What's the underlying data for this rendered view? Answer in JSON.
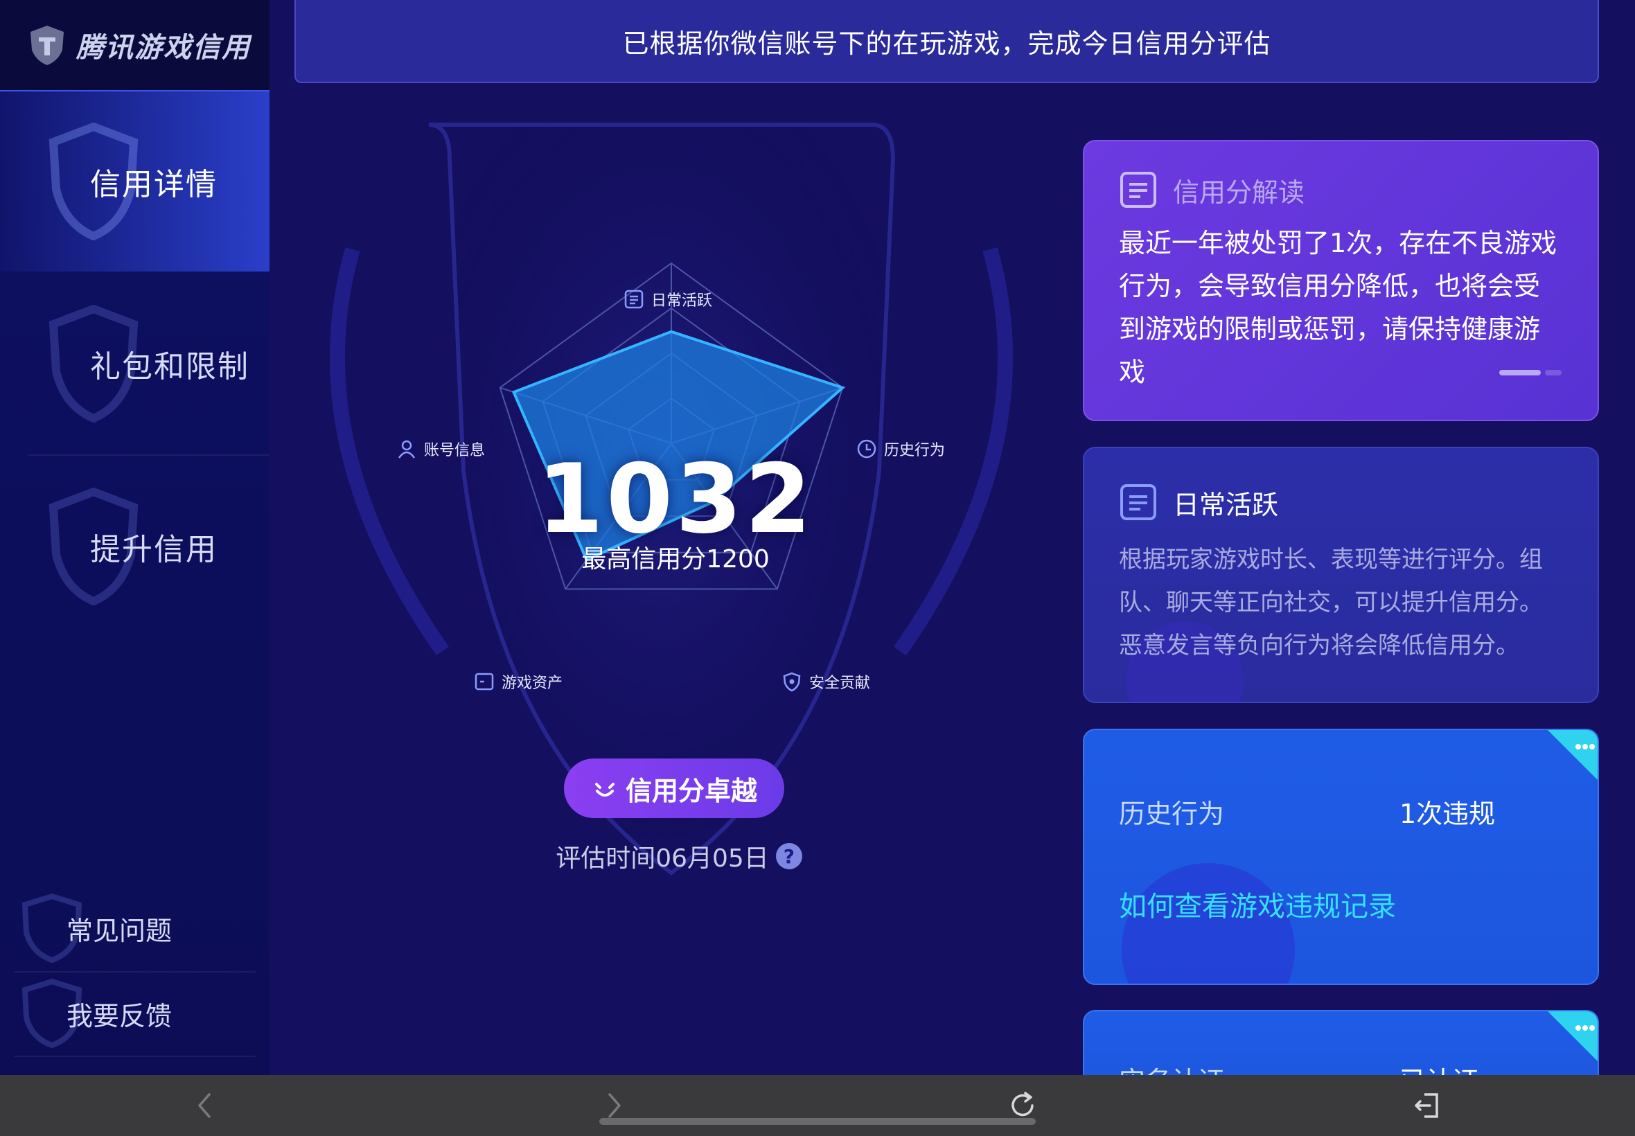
{
  "app": {
    "logo_text": "腾讯游戏信用"
  },
  "sidebar": {
    "items": [
      {
        "label": "信用详情",
        "active": true
      },
      {
        "label": "礼包和限制",
        "active": false
      },
      {
        "label": "提升信用",
        "active": false
      }
    ],
    "footer": [
      {
        "label": "常见问题"
      },
      {
        "label": "我要反馈"
      }
    ]
  },
  "banner": {
    "text": "已根据你微信账号下的在玩游戏，完成今日信用分评估"
  },
  "radar": {
    "axes": [
      "日常活跃",
      "历史行为",
      "安全贡献",
      "游戏资产",
      "账号信息"
    ],
    "values": [
      0.62,
      1.0,
      0.4,
      0.8,
      0.92
    ],
    "fill_color": "#1c7fe0",
    "stroke_color": "#35b4ff"
  },
  "score": {
    "value": "1032",
    "max_label": "最高信用分1200",
    "level_label": "信用分卓越",
    "eval_time": "评估时间06月05日",
    "help_icon": "question-icon"
  },
  "cards": {
    "interpretation": {
      "title": "信用分解读",
      "body": "最近一年被处罚了1次，存在不良游戏行为，会导致信用分降低，也将会受到游戏的限制或惩罚，请保持健康游戏"
    },
    "daily": {
      "title": "日常活跃",
      "body": "根据玩家游戏时长、表现等进行评分。组队、聊天等正向社交，可以提升信用分。恶意发言等负向行为将会降低信用分。"
    },
    "history": {
      "key": "历史行为",
      "value": "1次违规",
      "link": "如何查看游戏违规记录"
    },
    "realname": {
      "key": "实名认证",
      "value": "已认证"
    }
  },
  "browser": {
    "icons": [
      "back-icon",
      "forward-icon",
      "reload-icon",
      "exit-icon"
    ]
  },
  "colors": {
    "background": "#140f5e",
    "sidebar": "#0d1063",
    "accent_purple": "#6c3ae0",
    "accent_blue": "#1f5ce6",
    "link_cyan": "#38e0ff"
  }
}
